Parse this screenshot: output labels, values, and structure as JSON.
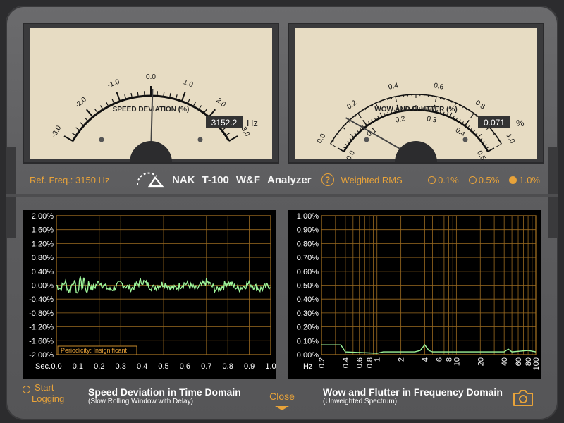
{
  "meter_left": {
    "title": "SPEED DEVIATION (%)",
    "scale_labels": [
      "-3.0",
      "-2.0",
      "-1.0",
      "0.0",
      "1.0",
      "2.0",
      "3.0"
    ],
    "value": "3152.2",
    "unit": "Hz",
    "needle_value": 0.05
  },
  "meter_right": {
    "title": "WOW AND FLUTTER (%)",
    "outer_labels": [
      "0.0",
      "0.2",
      "0.4",
      "0.6",
      "0.8",
      "1.0"
    ],
    "inner_labels": [
      "0.0",
      "0.1",
      "0.2",
      "0.3",
      "0.4",
      "0.5"
    ],
    "value": "0.071",
    "unit": "%",
    "needle_value": 0.071
  },
  "controls": {
    "ref_freq": "Ref. Freq.: 3150 Hz",
    "brand": "NAK",
    "model": "T-100",
    "wf": "W&F",
    "analyzer": "Analyzer",
    "help": "?",
    "weighted": "Weighted RMS",
    "ranges": [
      {
        "label": "0.1%",
        "selected": false
      },
      {
        "label": "0.5%",
        "selected": false
      },
      {
        "label": "1.0%",
        "selected": true
      }
    ]
  },
  "chart_data": [
    {
      "type": "line",
      "title": "Speed Deviation in Time Domain",
      "subtitle": "(Slow Rolling Window with Delay)",
      "xlabel": "Sec.",
      "x_ticks": [
        "0.0",
        "0.1",
        "0.2",
        "0.3",
        "0.4",
        "0.5",
        "0.6",
        "0.7",
        "0.8",
        "0.9",
        "1.0"
      ],
      "y_ticks": [
        "2.00%",
        "1.60%",
        "1.20%",
        "0.80%",
        "0.40%",
        "-0.00%",
        "-0.40%",
        "-0.80%",
        "-1.20%",
        "-1.60%",
        "-2.00%"
      ],
      "xlim": [
        0,
        1
      ],
      "ylim": [
        -2,
        2
      ],
      "annotation": "Periodicity: Insignificant",
      "series": [
        {
          "x": [
            0.0,
            0.02,
            0.04,
            0.06,
            0.08,
            0.1,
            0.11,
            0.12,
            0.13,
            0.14,
            0.15,
            0.17,
            0.2,
            0.25,
            0.3,
            0.35,
            0.4,
            0.45,
            0.5,
            0.55,
            0.6,
            0.65,
            0.7,
            0.75,
            0.8,
            0.85,
            0.9,
            0.95,
            1.0
          ],
          "y": [
            0.0,
            -0.1,
            0.1,
            -0.2,
            0.15,
            -0.3,
            0.3,
            -0.1,
            0.2,
            -0.25,
            0.05,
            -0.1,
            0.1,
            -0.15,
            0.05,
            -0.1,
            0.12,
            -0.08,
            0.05,
            -0.1,
            0.06,
            -0.12,
            0.1,
            -0.15,
            0.08,
            -0.1,
            0.05,
            -0.12,
            0.0
          ]
        }
      ]
    },
    {
      "type": "line",
      "title": "Wow and Flutter in Frequency Domain",
      "subtitle": "(Unweighted Spectrum)",
      "xlabel": "Hz",
      "x_ticks": [
        "0.2",
        "0.4",
        "0.6",
        "0.8",
        "1",
        "2",
        "4",
        "6",
        "8",
        "10",
        "20",
        "40",
        "60",
        "80",
        "100"
      ],
      "y_ticks": [
        "1.00%",
        "0.90%",
        "0.80%",
        "0.70%",
        "0.60%",
        "0.50%",
        "0.40%",
        "0.30%",
        "0.20%",
        "0.10%",
        "0.00%"
      ],
      "xlim": [
        0.2,
        100
      ],
      "ylim": [
        0,
        1
      ],
      "series": [
        {
          "x": [
            0.2,
            0.35,
            0.4,
            1,
            1.2,
            2,
            3,
            3.5,
            4,
            4.5,
            5,
            8,
            10,
            20,
            30,
            40,
            45,
            50,
            80,
            100
          ],
          "y": [
            0.07,
            0.07,
            0.02,
            0.01,
            0.02,
            0.02,
            0.02,
            0.03,
            0.07,
            0.03,
            0.02,
            0.02,
            0.02,
            0.02,
            0.02,
            0.02,
            0.04,
            0.02,
            0.03,
            0.02
          ]
        }
      ]
    }
  ],
  "bottom": {
    "start": "Start",
    "logging": "Logging",
    "close": "Close"
  }
}
